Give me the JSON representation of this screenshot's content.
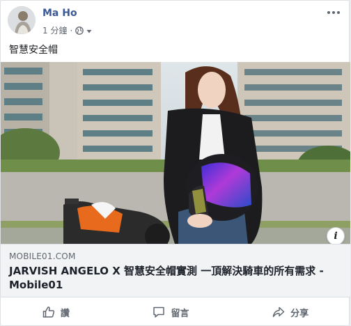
{
  "post": {
    "author": "Ma Ho",
    "time": "1 分鐘",
    "dot": "·",
    "privacy_icon": "globe-icon",
    "text": "智慧安全帽"
  },
  "link": {
    "domain": "MOBILE01.COM",
    "title": "JARVISH ANGELO X 智慧安全帽實測 一頂解決騎車的所有需求 - Mobile01",
    "info_label": "i"
  },
  "actions": {
    "like": "讚",
    "comment": "留言",
    "share": "分享"
  },
  "colors": {
    "author": "#385898",
    "secondary_text": "#606770",
    "link_bg": "#f2f3f5"
  }
}
